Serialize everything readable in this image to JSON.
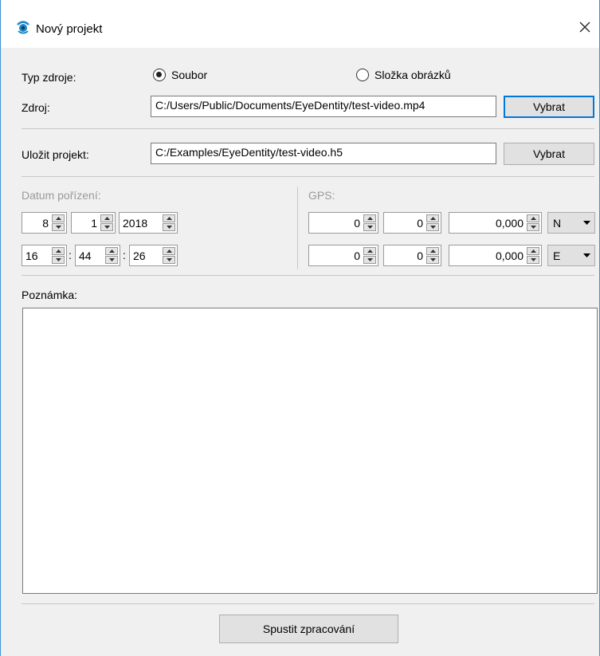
{
  "window": {
    "title": "Nový projekt"
  },
  "source_type": {
    "label": "Typ zdroje:",
    "options": [
      "Soubor",
      "Složka obrázků"
    ],
    "selected": "Soubor"
  },
  "source": {
    "label": "Zdroj:",
    "value": "C:/Users/Public/Documents/EyeDentity/test-video.mp4",
    "button": "Vybrat"
  },
  "save_project": {
    "label": "Uložit projekt:",
    "value": "C:/Examples/EyeDentity/test-video.h5",
    "button": "Vybrat"
  },
  "capture_date": {
    "label": "Datum pořízení:",
    "day": "8",
    "month": "1",
    "year": "2018",
    "hour": "16",
    "minute": "44",
    "second": "26",
    "time_separator": ":"
  },
  "gps": {
    "label": "GPS:",
    "lat": {
      "deg": "0",
      "min": "0",
      "sec": "0,000",
      "hemisphere": "N"
    },
    "lon": {
      "deg": "0",
      "min": "0",
      "sec": "0,000",
      "hemisphere": "E"
    }
  },
  "note": {
    "label": "Poznámka:",
    "value": ""
  },
  "run_button": "Spustit zpracování",
  "colors": {
    "accent": "#0078d7",
    "window_border": "#3c8fd6",
    "disabled_text": "#9a9a9a"
  }
}
